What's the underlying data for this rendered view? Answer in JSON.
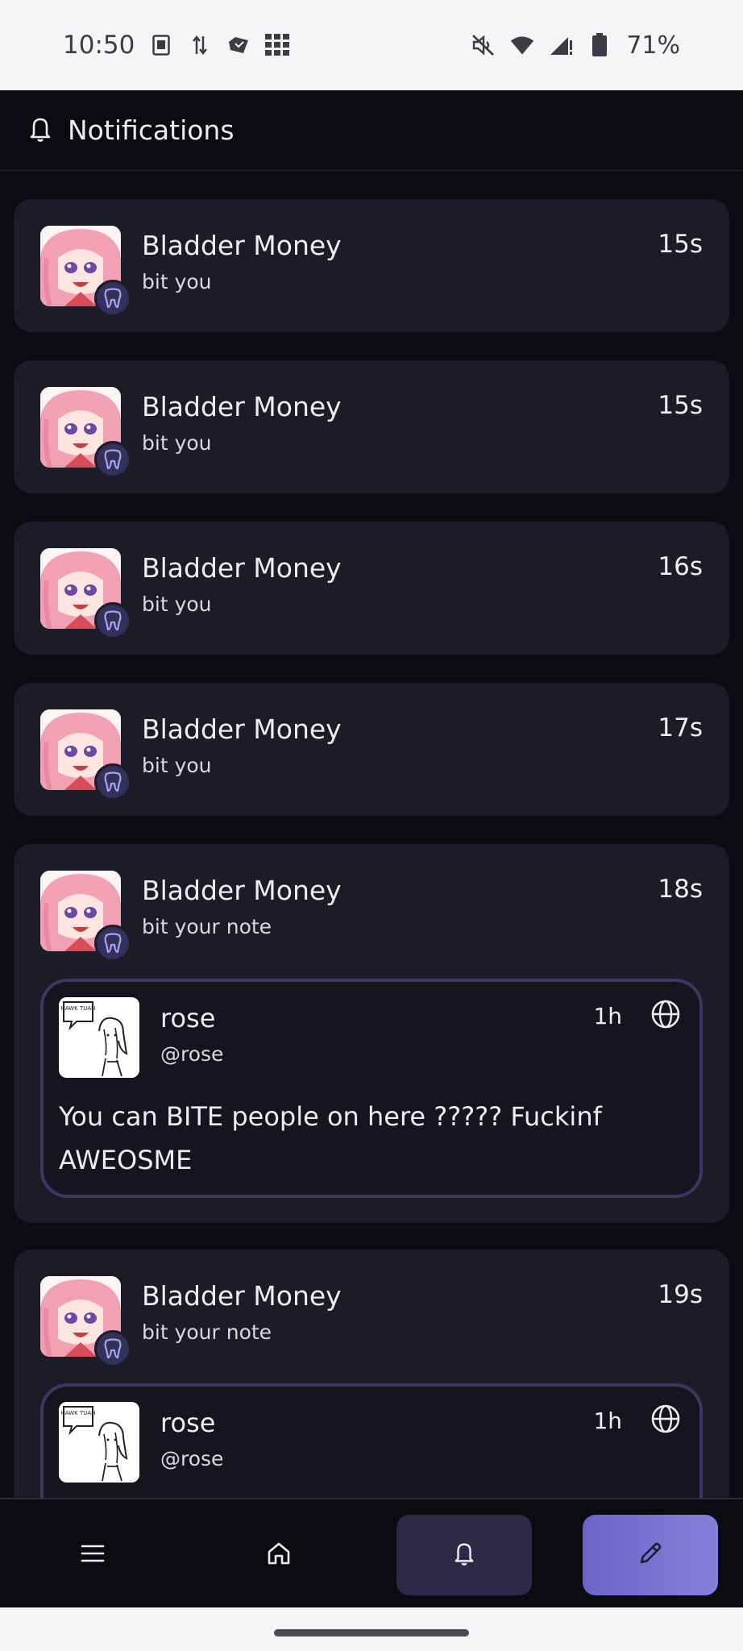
{
  "status_bar": {
    "time": "10:50",
    "battery": "71%",
    "left_icons": [
      "sim-card-icon",
      "data-transfer-icon",
      "app-notification-icon",
      "grid-app-icon"
    ],
    "right_icons": [
      "mute-icon",
      "wifi-icon",
      "signal-icon",
      "battery-icon"
    ]
  },
  "header": {
    "icon": "bell-icon",
    "title": "Notifications"
  },
  "notifications": [
    {
      "name": "Bladder Money",
      "action": "bit you",
      "time": "15s"
    },
    {
      "name": "Bladder Money",
      "action": "bit you",
      "time": "15s"
    },
    {
      "name": "Bladder Money",
      "action": "bit you",
      "time": "16s"
    },
    {
      "name": "Bladder Money",
      "action": "bit you",
      "time": "17s"
    },
    {
      "name": "Bladder Money",
      "action": "bit your note",
      "time": "18s",
      "note": {
        "name": "rose",
        "handle": "@rose",
        "time": "1h",
        "text": "You can BITE people on here ????? Fuckinf AWEOSME",
        "speech_bubble": "HAWK TUAH"
      }
    },
    {
      "name": "Bladder Money",
      "action": "bit your note",
      "time": "19s",
      "note": {
        "name": "rose",
        "handle": "@rose",
        "time": "1h",
        "speech_bubble": "HAWK TUAH"
      }
    }
  ],
  "bottom_nav": {
    "items": [
      "menu-icon",
      "home-icon",
      "bell-icon",
      "pencil-icon"
    ],
    "active": "bell-icon"
  },
  "colors": {
    "background": "#0b0b12",
    "card": "#1c1b28",
    "badge": "#33315a",
    "note_border": "#3b3760",
    "accent": "#7a72d4"
  }
}
